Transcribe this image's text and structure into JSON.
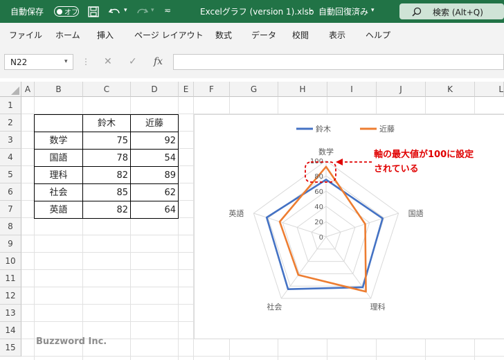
{
  "titlebar": {
    "autosave_label": "自動保存",
    "autosave_state": "オフ",
    "filename": "Excelグラフ (version 1).xlsb",
    "separator": "-",
    "save_status": "自動回復済み",
    "search_label": "検索 (Alt+Q)"
  },
  "menu": [
    "ファイル",
    "ホーム",
    "挿入",
    "ページ レイアウト",
    "数式",
    "データ",
    "校閲",
    "表示",
    "ヘルプ"
  ],
  "formula_bar": {
    "name_box": "N22",
    "fx": "fx",
    "content": ""
  },
  "columns": [
    "A",
    "B",
    "C",
    "D",
    "E",
    "F",
    "G",
    "H",
    "I",
    "J",
    "K",
    "L"
  ],
  "rows": [
    "1",
    "2",
    "3",
    "4",
    "5",
    "6",
    "7",
    "8",
    "9",
    "10",
    "11",
    "12",
    "13",
    "14",
    "15"
  ],
  "table": {
    "headers": [
      "",
      "鈴木",
      "近藤"
    ],
    "rows": [
      [
        "数学",
        "75",
        "92"
      ],
      [
        "国語",
        "78",
        "54"
      ],
      [
        "理科",
        "82",
        "89"
      ],
      [
        "社会",
        "85",
        "62"
      ],
      [
        "英語",
        "82",
        "64"
      ]
    ]
  },
  "chart_data": {
    "type": "radar",
    "categories": [
      "数学",
      "国語",
      "理科",
      "社会",
      "英語"
    ],
    "series": [
      {
        "name": "鈴木",
        "values": [
          75,
          78,
          82,
          85,
          82
        ],
        "color": "#4472c4"
      },
      {
        "name": "近藤",
        "values": [
          92,
          54,
          89,
          62,
          64
        ],
        "color": "#ed7d31"
      }
    ],
    "axis_ticks": [
      "0",
      "20",
      "40",
      "60",
      "80",
      "100"
    ],
    "rlim": [
      0,
      100
    ],
    "grid": true,
    "legend": "top"
  },
  "annotation": {
    "text_line1": "軸の最大値が100に設定",
    "text_line2": "されている",
    "color": "#e00000"
  },
  "watermark": "Buzzword Inc."
}
